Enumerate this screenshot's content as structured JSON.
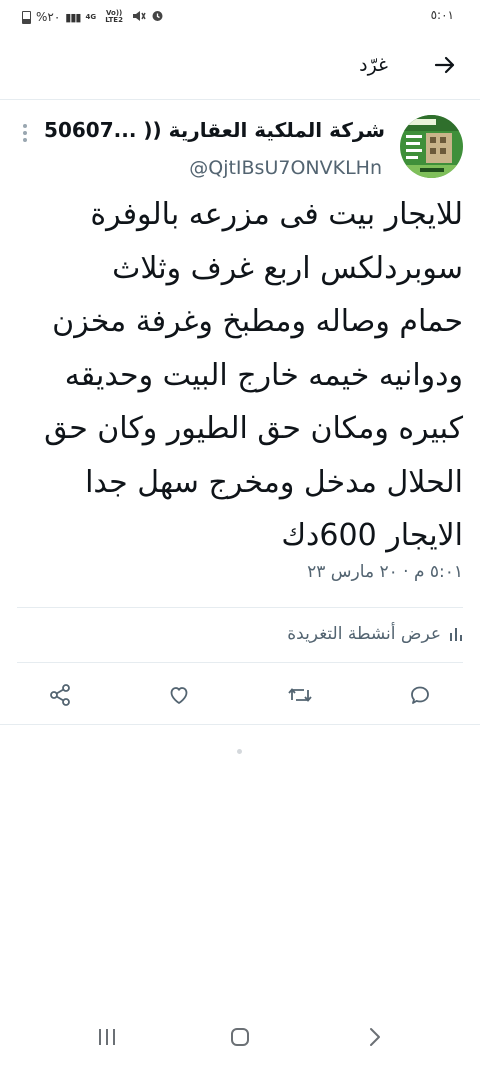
{
  "status_bar": {
    "time": "٥:٠١",
    "battery_percent": "%٢٠",
    "network_label": "4G",
    "volte_label": "Vo)) LTE2",
    "battery_level": 0.2
  },
  "header": {
    "title": "غرّد",
    "back_icon": "arrow-right-icon"
  },
  "tweet": {
    "author_name": "شركة الملكية العقارية (( ...50607",
    "author_handle": "@QjtIBsU7ONVKLHn",
    "text": "للايجار بيت فى مزرعه بالوفرة\nسوبردلكس اربع غرف وثلاث\nحمام وصاله ومطبخ وغرفة مخزن\nودوانيه خيمه خارج البيت وحديقه\nكبيره ومكان حق الطيور وكان حق\nالحلال  مدخل ومخرج سهل جدا\nالايجار 600دك",
    "timestamp": "٥:٠١ م · ٢٠ مارس ٢٣",
    "activity_label": "عرض أنشطة التغريدة"
  },
  "actions": {
    "reply_icon": "reply-icon",
    "retweet_icon": "retweet-icon",
    "like_icon": "heart-icon",
    "share_icon": "share-icon"
  },
  "colors": {
    "text": "#0f1419",
    "muted": "#536471",
    "divider": "#e6ecf0",
    "icon": "#536471"
  }
}
